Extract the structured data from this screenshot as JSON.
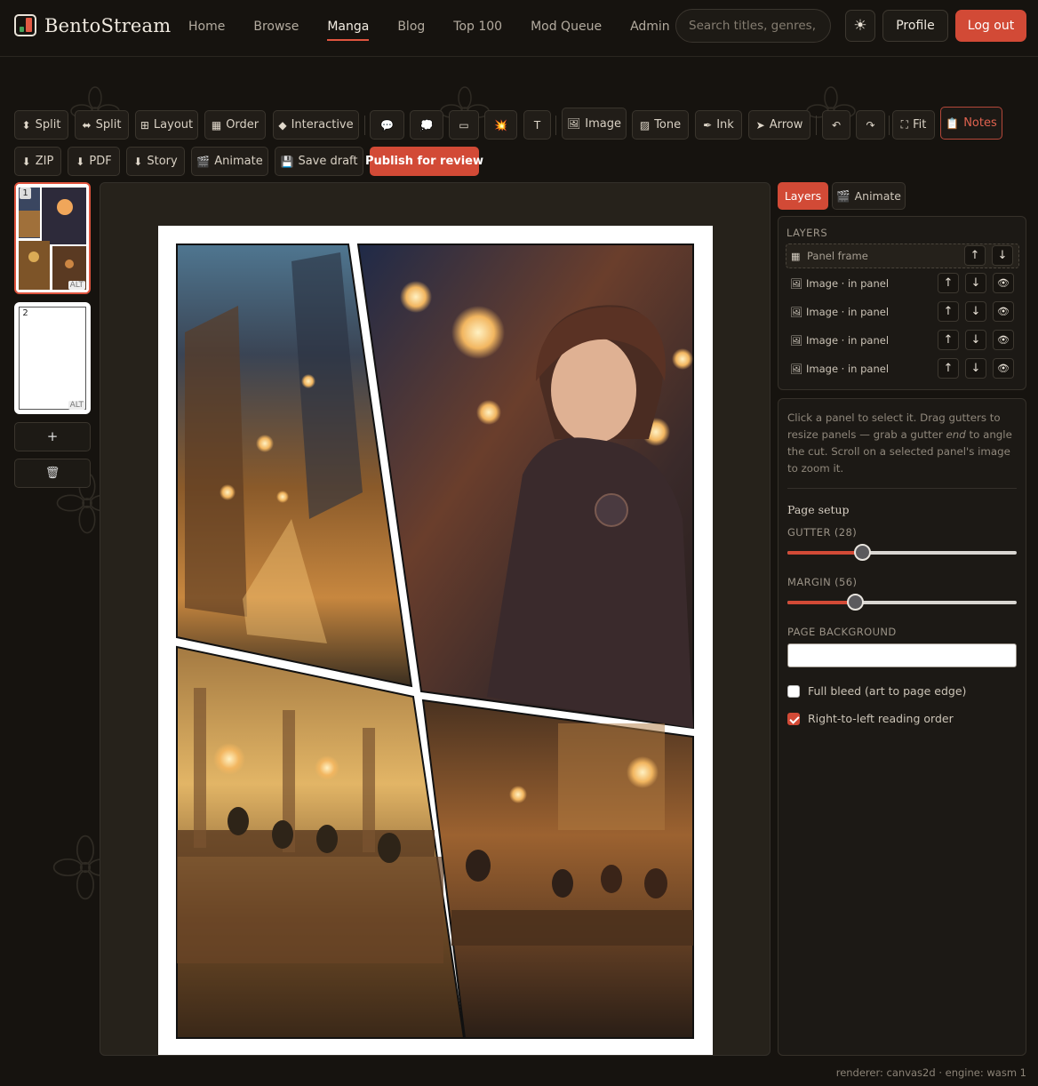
{
  "brand": {
    "name": "BentoStream"
  },
  "nav": {
    "items": [
      "Home",
      "Browse",
      "Manga",
      "Blog",
      "Top 100",
      "Mod Queue",
      "Admin"
    ],
    "active": "Manga"
  },
  "search": {
    "placeholder": "Search titles, genres, stu",
    "value": ""
  },
  "header_actions": {
    "theme_icon": "☀",
    "profile": "Profile",
    "logout": "Log out"
  },
  "toolbar": {
    "row1": {
      "split_v": {
        "icon": "⬍",
        "label": "Split"
      },
      "split_h": {
        "icon": "⬌",
        "label": "Split"
      },
      "layout": {
        "icon": "⊞",
        "label": "Layout"
      },
      "order": {
        "icon": "▦",
        "label": "Order"
      },
      "interactive": {
        "icon": "◆",
        "label": "Interactive"
      },
      "speech": {
        "icon": "💬"
      },
      "thought": {
        "icon": "💭"
      },
      "caption": {
        "icon": "▭"
      },
      "sfx": {
        "icon": "💥"
      },
      "text": {
        "icon": "T"
      },
      "image": {
        "icon": "🖼",
        "label": "Image"
      },
      "tone": {
        "icon": "▨",
        "label": "Tone"
      },
      "ink": {
        "icon": "✒",
        "label": "Ink"
      },
      "arrow": {
        "icon": "➤",
        "label": "Arrow"
      },
      "undo": {
        "icon": "↶"
      },
      "redo": {
        "icon": "↷"
      },
      "fit": {
        "icon": "⛶",
        "label": "Fit"
      },
      "notes": {
        "icon": "📋",
        "label": "Notes"
      }
    },
    "row2": {
      "zip": {
        "icon": "⬇",
        "label": "ZIP"
      },
      "pdf": {
        "icon": "⬇",
        "label": "PDF"
      },
      "story": {
        "icon": "⬇",
        "label": "Story"
      },
      "animate": {
        "icon": "🎬",
        "label": "Animate"
      },
      "save_draft": {
        "icon": "💾",
        "label": "Save draft"
      },
      "publish": {
        "label": "Publish for review"
      }
    }
  },
  "pages": [
    {
      "number": "1",
      "alt": "ALT",
      "active": true
    },
    {
      "number": "2",
      "alt": "ALT",
      "active": false
    }
  ],
  "sidebar_actions": {
    "add": "+",
    "delete_icon": "🗑"
  },
  "right_tabs": {
    "layers": "Layers",
    "animate": {
      "icon": "🎬",
      "label": "Animate"
    }
  },
  "layers": {
    "title": "LAYERS",
    "items": [
      {
        "icon": "▦",
        "name": "Panel frame",
        "selected": true,
        "visibility": false
      },
      {
        "icon": "🖼",
        "name": "Image · in panel",
        "selected": false,
        "visibility": true
      },
      {
        "icon": "🖼",
        "name": "Image · in panel",
        "selected": false,
        "visibility": true
      },
      {
        "icon": "🖼",
        "name": "Image · in panel",
        "selected": false,
        "visibility": true
      },
      {
        "icon": "🖼",
        "name": "Image · in panel",
        "selected": false,
        "visibility": true
      }
    ],
    "up_icon": "↑",
    "down_icon": "↓",
    "eye_icon": "👁"
  },
  "properties": {
    "help_before": "Click a panel to select it. Drag gutters to resize panels — grab a gutter ",
    "help_em": "end",
    "help_after": " to angle the cut. Scroll on a selected panel's image to zoom it.",
    "section_title": "Page setup",
    "gutter_label": "GUTTER (28)",
    "gutter_value": 28,
    "gutter_fraction": 0.33,
    "margin_label": "MARGIN (56)",
    "margin_value": 56,
    "margin_fraction": 0.3,
    "page_background_label": "PAGE BACKGROUND",
    "page_background": "#ffffff",
    "full_bleed_label": "Full bleed (art to page edge)",
    "full_bleed": false,
    "rtl_label": "Right-to-left reading order",
    "rtl": true
  },
  "footer": {
    "renderer": "renderer: canvas2d · engine: wasm 1"
  },
  "colors": {
    "accent": "#d24a36",
    "background": "#16130f",
    "panel": "#1c1915"
  }
}
